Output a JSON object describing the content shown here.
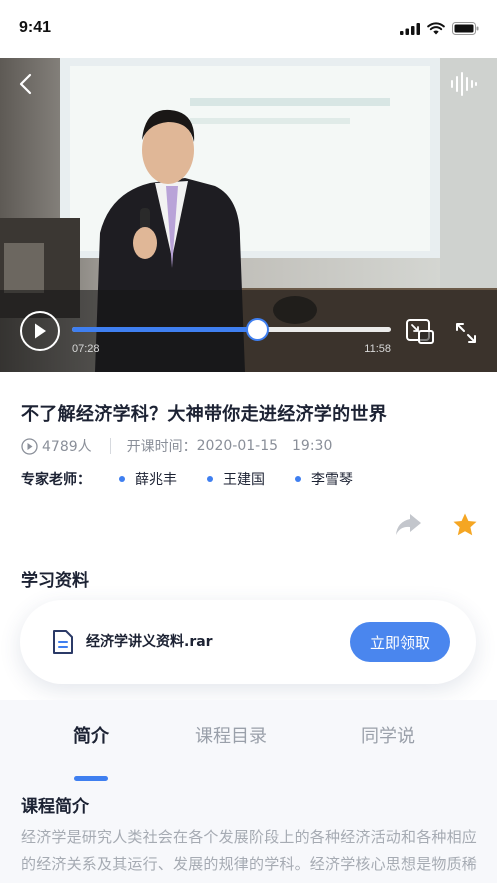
{
  "status_bar": {
    "time": "9:41"
  },
  "video": {
    "current_time": "07:28",
    "total_time": "11:58",
    "progress": 0.58
  },
  "course": {
    "title": "不了解经济学科？大神带你走进经济学的世界",
    "views": "4789人",
    "start_label": "开课时间：",
    "start_date": "2020-01-15",
    "start_time": "19:30",
    "experts_label": "专家老师：",
    "experts": [
      "薛兆丰",
      "王建国",
      "李雪琴"
    ]
  },
  "materials": {
    "title": "学习资料",
    "file_name": "经济学讲义资料.rar",
    "get_button": "立即领取"
  },
  "tabs": [
    {
      "label": "简介",
      "active": true
    },
    {
      "label": "课程目录",
      "active": false
    },
    {
      "label": "同学说",
      "active": false
    }
  ],
  "intro": {
    "title": "课程简介",
    "text": "经济学是研究人类社会在各个发展阶段上的各种经济活动和各种相应的经济关系及其运行、发展的规律的学科。经济学核心思想是物质稀缺性和有效利用资源，可分为两大主要分支，微"
  },
  "colors": {
    "accent": "#3f7ff0",
    "star": "#f5a623"
  }
}
